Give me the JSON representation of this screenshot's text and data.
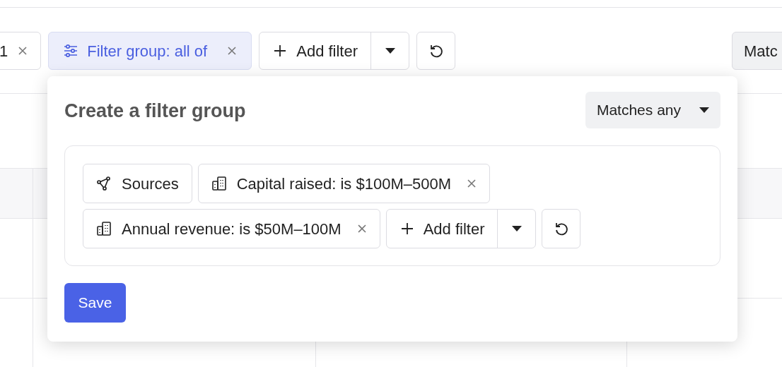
{
  "toolbar": {
    "chips": [
      {
        "kind": "filter",
        "label": "1"
      },
      {
        "kind": "group",
        "label": "Filter group: all of"
      }
    ],
    "add_filter": "Add filter",
    "match_button": "Matc"
  },
  "popup": {
    "title": "Create a filter group",
    "match_mode": "Matches any",
    "filters": [
      {
        "kind": "sources",
        "label": "Sources",
        "removable": false
      },
      {
        "kind": "building",
        "label": "Capital raised: is $100M–500M",
        "removable": true
      },
      {
        "kind": "building",
        "label": "Annual revenue: is $50M–100M",
        "removable": true
      }
    ],
    "add_filter": "Add filter",
    "save": "Save"
  }
}
